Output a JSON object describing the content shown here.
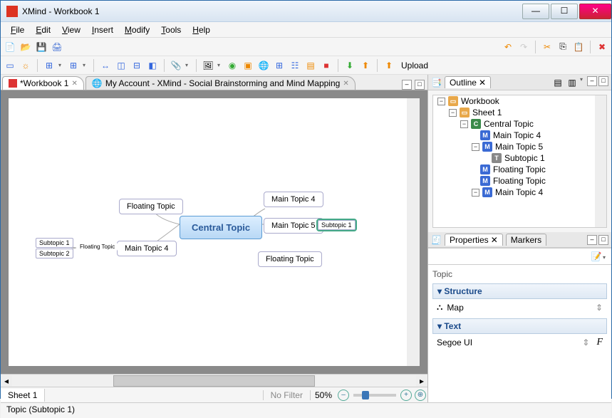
{
  "window": {
    "title": "XMind - Workbook 1"
  },
  "menu": [
    "File",
    "Edit",
    "View",
    "Insert",
    "Modify",
    "Tools",
    "Help"
  ],
  "toolbar2": {
    "upload": "Upload"
  },
  "tabs": {
    "workbook": "*Workbook 1",
    "web": "My Account - XMind - Social Brainstorming and Mind Mapping"
  },
  "canvas": {
    "central": "Central Topic",
    "mt4": "Main Topic 4",
    "mt5": "Main Topic 5",
    "sub1": "Subtopic 1",
    "sub2": "Subtopic 2",
    "floating": "Floating Topic",
    "mt4b": "Main Topic 4"
  },
  "sheetbar": {
    "sheet": "Sheet 1",
    "filter": "No Filter",
    "zoom": "50%"
  },
  "outline": {
    "title": "Outline",
    "items": {
      "wb": "Workbook",
      "sh": "Sheet 1",
      "ct": "Central Topic",
      "m4": "Main Topic 4",
      "m5": "Main Topic 5",
      "s1": "Subtopic 1",
      "f1": "Floating Topic",
      "f2": "Floating Topic",
      "m4b": "Main Topic 4"
    }
  },
  "properties": {
    "tab1": "Properties",
    "tab2": "Markers",
    "topic": "Topic",
    "structure": "Structure",
    "structure_val": "Map",
    "text": "Text",
    "font": "Segoe UI"
  },
  "status": "Topic (Subtopic 1)"
}
